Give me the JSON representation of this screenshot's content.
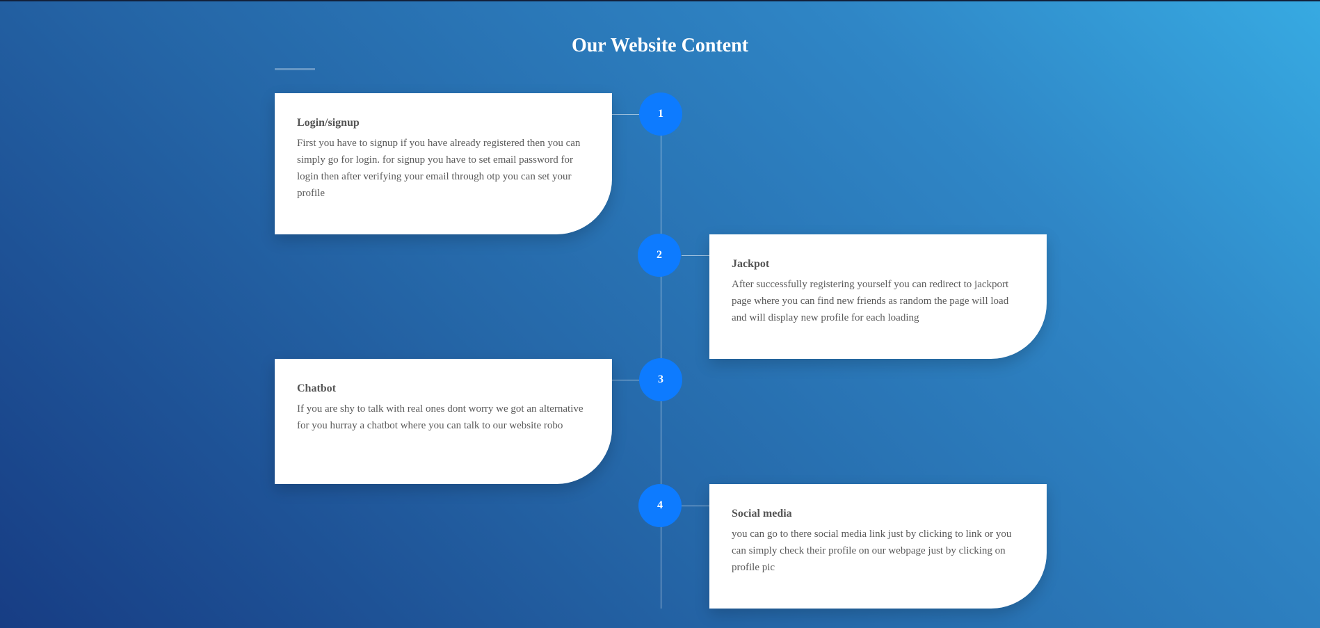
{
  "header": {
    "title": "Our Website Content"
  },
  "steps": [
    {
      "number": "1",
      "title": "Login/signup",
      "text": "First you have to signup if you have already registered then you can simply go for login. for signup you have to set email password for login then after verifying your email through otp you can set your profile"
    },
    {
      "number": "2",
      "title": "Jackpot",
      "text": "After successfully registering yourself you can redirect to jackport page where you can find new friends as random the page will load and will display new profile for each loading"
    },
    {
      "number": "3",
      "title": "Chatbot",
      "text": "If you are shy to talk with real ones dont worry we got an alternative for you hurray a chatbot where you can talk to our website robo"
    },
    {
      "number": "4",
      "title": "Social media",
      "text": "you can go to there social media link just by clicking to link or you can simply check their profile on our webpage just by clicking on profile pic"
    }
  ],
  "colors": {
    "step_circle": "#0d7bff",
    "card_background": "#ffffff",
    "title_text": "#ffffff"
  }
}
